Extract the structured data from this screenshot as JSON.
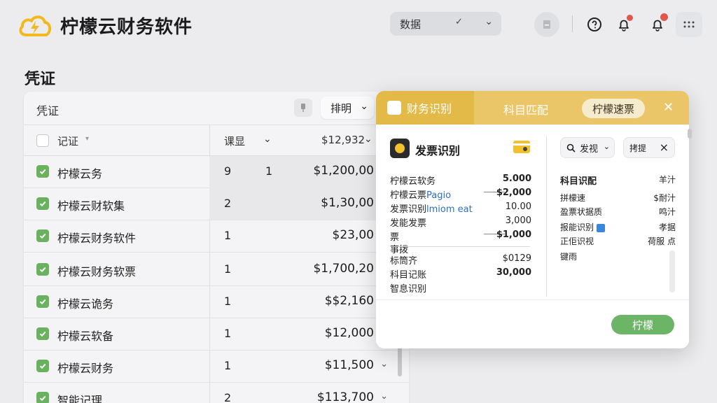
{
  "app": {
    "title": "柠檬云财务软件"
  },
  "topbar": {
    "select_label": "数据"
  },
  "section": {
    "title": "凭证"
  },
  "card": {
    "title": "凭证",
    "sort_label": "排明",
    "columns": {
      "name": "记证",
      "qty": "课显",
      "amount": "$12,932"
    }
  },
  "rows": [
    {
      "name": "柠檬云务",
      "qty": "9",
      "qty2": "1",
      "amount": "$1,200,00",
      "chev": ""
    },
    {
      "name": "柠檬云财软集",
      "qty": "2",
      "qty2": "",
      "amount": "$1,30,00",
      "chev": ""
    },
    {
      "name": "柠檬云财务软件",
      "qty": "1",
      "qty2": "",
      "amount": "$23,00",
      "chev": ""
    },
    {
      "name": "柠檬云财务软票",
      "qty": "1",
      "qty2": "",
      "amount": "$1,700,20",
      "chev": ""
    },
    {
      "name": "柠檬云诡务",
      "qty": "1",
      "qty2": "",
      "amount": "$$2,160",
      "chev": ""
    },
    {
      "name": "柠檬云软备",
      "qty": "1",
      "qty2": "",
      "amount": "$12,000",
      "chev": ""
    },
    {
      "name": "柠檬云财务",
      "qty": "1",
      "qty2": "",
      "amount": "$11,500",
      "chev": "⌄"
    },
    {
      "name": "智能记理",
      "qty": "2",
      "qty2": "",
      "amount": "$113,700",
      "chev": "⌄"
    }
  ],
  "popup": {
    "tabs": [
      "财务识别",
      "科目匹配",
      "柠檬速票"
    ],
    "invoice_title": "发票识别",
    "invoice_rows": [
      {
        "label": "柠檬云软务",
        "extra": "",
        "value": "5.000",
        "bold": true
      },
      {
        "label": "柠檬云票",
        "extra": "Pagio",
        "value": "$2,000",
        "bold": true
      },
      {
        "label": "发票识别",
        "extra": "lmiom eat",
        "value": "10.00",
        "bold": false
      },
      {
        "label": "发能发票",
        "extra": "",
        "value": "3,000",
        "bold": false
      },
      {
        "label": "票",
        "extra": "",
        "value": "$1,000",
        "bold": true
      },
      {
        "label": "事拨",
        "extra": "",
        "value": "",
        "bold": false
      },
      {
        "label": "标筒齐",
        "extra": "",
        "value": "$0129",
        "bold": false
      },
      {
        "label": "科目记账",
        "extra": "",
        "value": "30,000",
        "bold": true
      },
      {
        "label": "智息识别",
        "extra": "",
        "value": "",
        "bold": false
      }
    ],
    "search_label": "发视",
    "filter_label": "拷提",
    "match_head": {
      "label": "科目识配",
      "value": "羊汁"
    },
    "match_rows": [
      {
        "label": "拼檬速",
        "value": "$耐汁"
      },
      {
        "label": "盈票状据质",
        "value": "鸣汁"
      },
      {
        "label": "报能识别",
        "value": "孝据"
      },
      {
        "label": "正佢识视",
        "value": "荷服 点"
      },
      {
        "label": "键雨",
        "value": ""
      }
    ],
    "confirm_label": "柠檬"
  },
  "colors": {
    "accent_yellow": "#e3b947",
    "tab_bar": "#eac668",
    "green": "#6cb466",
    "badge_red": "#e2574c"
  }
}
